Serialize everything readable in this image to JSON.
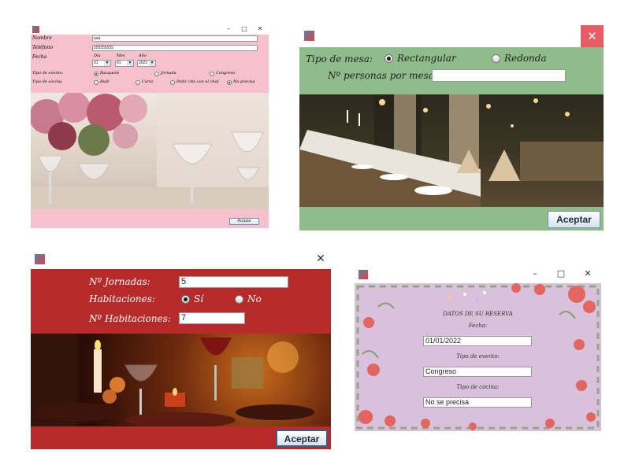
{
  "win1": {
    "min_icon": "minimize-icon",
    "max_icon": "maximize-icon",
    "close_icon": "close-icon",
    "labels": {
      "nombre": "Nombre",
      "telefono": "Teléfono",
      "fecha": "Fecha",
      "dia": "Día",
      "mes": "Mes",
      "ano": "Año",
      "tipo_evento": "Tipo de evento:",
      "tipo_cocina": "Tipo de cocina:"
    },
    "nombre_value": "aaa",
    "telefono_value": "555555555",
    "dia_value": "01",
    "mes_value": "01",
    "ano_value": "2022",
    "evento_options": [
      "Banquete",
      "Jornada",
      "Congreso"
    ],
    "cocina_options": [
      "Bufé",
      "Carta",
      "Pedir cita con el chef",
      "No precisa"
    ],
    "accept": "Aceptar",
    "accent": "#f6c1cc"
  },
  "win2": {
    "close_icon": "close-icon",
    "tipo_mesa": "Tipo de mesa:",
    "opt_rect": "Rectangular",
    "opt_red": "Redonda",
    "personas": "Nº personas por mesa:",
    "personas_value": "",
    "accept": "Aceptar",
    "accent": "#8fbc8a",
    "close_bg": "#e65d63"
  },
  "win3": {
    "close_icon": "close-icon",
    "jornadas_label": "Nº Jornadas:",
    "jornadas_value": "5",
    "habitaciones_label": "Habitaciones:",
    "opt_si": "Sí",
    "opt_no": "No",
    "n_hab_label": "Nº Habitaciones:",
    "n_hab_value": "7",
    "accept": "Aceptar",
    "accent": "#b72a2a"
  },
  "win4": {
    "min_icon": "minimize-icon",
    "max_icon": "maximize-icon",
    "close_icon": "close-icon",
    "heading": "DATOS DE SU RESERVA",
    "fecha_label": "Fecha:",
    "fecha_value": "01/01/2022",
    "evento_label": "Tipo de evento:",
    "evento_value": "Congreso",
    "cocina_label": "Tipo de cocina:",
    "cocina_value": "No se precisa",
    "accent": "#d9c1dc"
  }
}
